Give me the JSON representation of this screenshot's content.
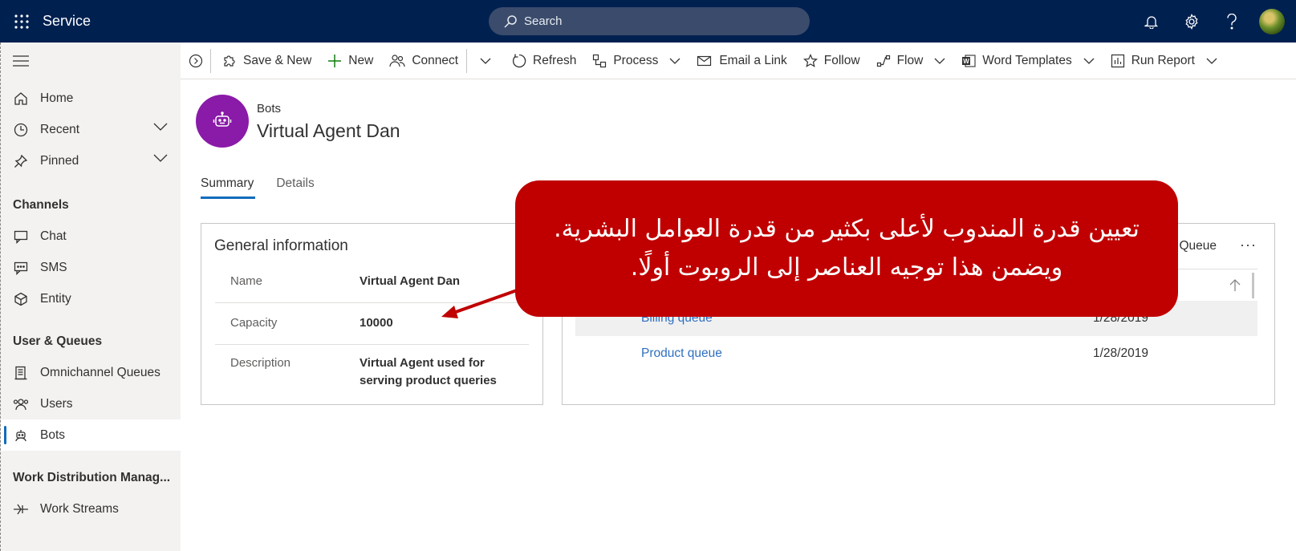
{
  "topbar": {
    "app_name": "Service",
    "search_placeholder": "Search",
    "icons": [
      "waffle-icon",
      "search-icon",
      "bell-icon",
      "gear-icon",
      "help-icon",
      "avatar"
    ]
  },
  "sidebar": {
    "items_top": [
      {
        "label": "Home",
        "icon": "home-icon"
      },
      {
        "label": "Recent",
        "icon": "clock-icon"
      },
      {
        "label": "Pinned",
        "icon": "pin-icon"
      }
    ],
    "groups": [
      {
        "title": "Channels",
        "items": [
          {
            "label": "Chat",
            "icon": "chat-icon"
          },
          {
            "label": "SMS",
            "icon": "sms-icon"
          },
          {
            "label": "Entity",
            "icon": "cube-icon"
          }
        ]
      },
      {
        "title": "User & Queues",
        "items": [
          {
            "label": "Omnichannel Queues",
            "icon": "queue-icon"
          },
          {
            "label": "Users",
            "icon": "users-icon"
          },
          {
            "label": "Bots",
            "icon": "bot-icon"
          }
        ]
      },
      {
        "title": "Work Distribution Manag...",
        "items": [
          {
            "label": "Work Streams",
            "icon": "workstream-icon"
          }
        ]
      }
    ],
    "active": "Bots"
  },
  "commands": {
    "save_new": "Save & New",
    "new": "New",
    "connect": "Connect",
    "refresh": "Refresh",
    "process": "Process",
    "email_link": "Email a Link",
    "follow": "Follow",
    "flow": "Flow",
    "word_templates": "Word Templates",
    "run_report": "Run Report"
  },
  "record": {
    "entity": "Bots",
    "title": "Virtual Agent Dan"
  },
  "tabs": [
    "Summary",
    "Details"
  ],
  "general": {
    "title": "General information",
    "fields": [
      {
        "label": "Name",
        "value": "Virtual Agent Dan"
      },
      {
        "label": "Capacity",
        "value": "10000"
      },
      {
        "label": "Description",
        "value": "Virtual Agent used for serving product queries"
      }
    ]
  },
  "queues": {
    "title_fragment": "Queue",
    "more": "···",
    "rows": [
      {
        "name": "Billing queue",
        "date": "1/28/2019"
      },
      {
        "name": "Product queue",
        "date": "1/28/2019"
      }
    ]
  },
  "callout": {
    "line1": "تعيين قدرة المندوب لأعلى بكثير من قدرة العوامل البشرية.",
    "line2": "ويضمن هذا توجيه العناصر إلى الروبوت أولًا.",
    "color": "#c00000"
  },
  "colors": {
    "topbar": "#002050",
    "accent": "#0f6cbd",
    "bot_avatar": "#8a1aa8",
    "link": "#2f6fbf"
  }
}
